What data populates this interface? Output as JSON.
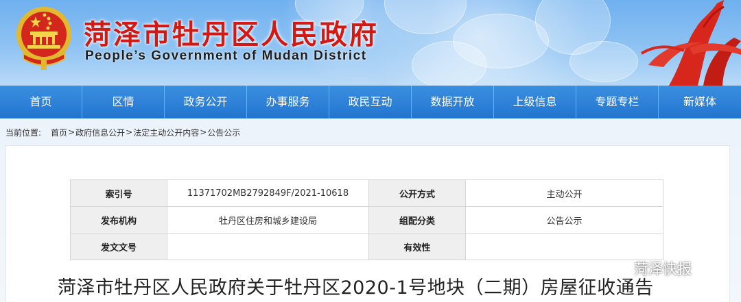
{
  "header": {
    "title": "菏泽市牡丹区人民政府",
    "subtitle": "People’s Government of Mudan District",
    "brand_red": "#d11a14"
  },
  "nav": {
    "items": [
      {
        "label": "首页"
      },
      {
        "label": "区情"
      },
      {
        "label": "政务公开"
      },
      {
        "label": "办事服务"
      },
      {
        "label": "政民互动"
      },
      {
        "label": "数据开放"
      },
      {
        "label": "上级信息"
      },
      {
        "label": "专题专栏"
      },
      {
        "label": "新媒体"
      }
    ],
    "color": "#2a7dd6"
  },
  "breadcrumb": {
    "label": "当前位置:",
    "items": [
      "首页",
      "政府信息公开",
      "法定主动公开内容",
      "公告公示"
    ],
    "separator": ">"
  },
  "meta": {
    "index_no_label": "索引号",
    "index_no_value": "11371702MB2792849F/2021-10618",
    "disclosure_label": "公开方式",
    "disclosure_value": "主动公开",
    "publisher_label": "发布机构",
    "publisher_value": "牡丹区住房和城乡建设局",
    "category_label": "组配分类",
    "category_value": "公告公示",
    "doc_no_label": "发文文号",
    "doc_no_value": "",
    "validity_label": "有效性",
    "validity_value": ""
  },
  "article": {
    "title": "菏泽市牡丹区人民政府关于牡丹区2020-1号地块（二期）房屋征收通告"
  },
  "watermark": {
    "text": "菏泽快报",
    "icon": "wechat-icon"
  }
}
